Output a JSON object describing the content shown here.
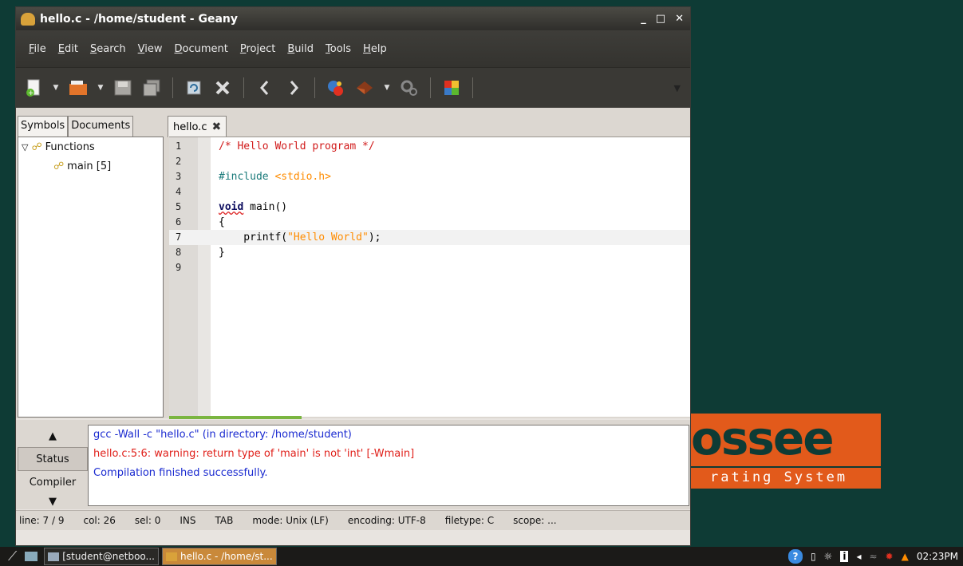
{
  "window": {
    "title": "hello.c - /home/student - Geany",
    "controls": {
      "minimize": "_",
      "maximize": "□",
      "close": "✕"
    }
  },
  "menu": [
    {
      "pre": "",
      "u": "F",
      "post": "ile"
    },
    {
      "pre": "",
      "u": "E",
      "post": "dit"
    },
    {
      "pre": "",
      "u": "S",
      "post": "earch"
    },
    {
      "pre": "",
      "u": "V",
      "post": "iew"
    },
    {
      "pre": "",
      "u": "D",
      "post": "ocument"
    },
    {
      "pre": "",
      "u": "P",
      "post": "roject"
    },
    {
      "pre": "",
      "u": "B",
      "post": "uild"
    },
    {
      "pre": "",
      "u": "T",
      "post": "ools"
    },
    {
      "pre": "",
      "u": "H",
      "post": "elp"
    }
  ],
  "toolbar": {
    "icons": [
      "new-file-icon",
      "open-file-icon",
      "save-icon",
      "save-all-icon",
      "revert-icon",
      "close-file-icon",
      "navigate-back-icon",
      "navigate-forward-icon",
      "compile-icon",
      "build-icon",
      "execute-icon",
      "color-chooser-icon"
    ],
    "more": "▼"
  },
  "sidebar": {
    "tabs": [
      "Symbols",
      "Documents"
    ],
    "active_tab": "Symbols",
    "tree": {
      "group_label": "Functions",
      "items": [
        "main [5]"
      ]
    }
  },
  "editor": {
    "tab_label": "hello.c",
    "lines": [
      {
        "n": "1",
        "parts": [
          {
            "t": "/* Hello World program */",
            "c": "c-comment"
          }
        ]
      },
      {
        "n": "2",
        "parts": []
      },
      {
        "n": "3",
        "parts": [
          {
            "t": "#include ",
            "c": "c-pre"
          },
          {
            "t": "<stdio.h>",
            "c": "c-str"
          }
        ]
      },
      {
        "n": "4",
        "parts": []
      },
      {
        "n": "5",
        "parts": [
          {
            "t": "void",
            "c": "c-kw"
          },
          {
            "t": " main()",
            "c": "c-plain"
          }
        ]
      },
      {
        "n": "6",
        "parts": [
          {
            "t": "{",
            "c": "c-plain"
          }
        ]
      },
      {
        "n": "7",
        "parts": [
          {
            "t": "    printf(",
            "c": "c-plain"
          },
          {
            "t": "\"Hello World\"",
            "c": "c-str"
          },
          {
            "t": ");",
            "c": "c-plain"
          }
        ]
      },
      {
        "n": "8",
        "parts": [
          {
            "t": "}",
            "c": "c-plain"
          }
        ]
      },
      {
        "n": "9",
        "parts": []
      }
    ],
    "current_line": 7
  },
  "messages": {
    "tabs": [
      "Status",
      "Compiler"
    ],
    "active_tab": "Status",
    "lines": [
      {
        "text": "gcc -Wall -c \"hello.c\" (in directory: /home/student)",
        "color": "#1a2ad0"
      },
      {
        "text": "hello.c:5:6: warning: return type of 'main' is not 'int' [-Wmain]",
        "color": "#e0201a"
      },
      {
        "text": "Compilation finished successfully.",
        "color": "#1a2ad0"
      }
    ]
  },
  "statusbar": {
    "line": "line: 7 / 9",
    "col": "col: 26",
    "sel": "sel: 0",
    "ins": "INS",
    "tab": "TAB",
    "mode": "mode: Unix (LF)",
    "encoding": "encoding: UTF-8",
    "filetype": "filetype: C",
    "scope": "scope: ..."
  },
  "desktop": {
    "logo_top": "ossee",
    "logo_bottom": "rating System"
  },
  "taskbar": {
    "tasks": [
      {
        "label": "[student@netboo...",
        "active": false
      },
      {
        "label": "hello.c - /home/st...",
        "active": true
      }
    ],
    "clock": "02:23PM"
  },
  "colors": {
    "desktop_bg": "#0e3b35",
    "logo_orange": "#e25a1b",
    "window_dark": "#3a3935"
  }
}
